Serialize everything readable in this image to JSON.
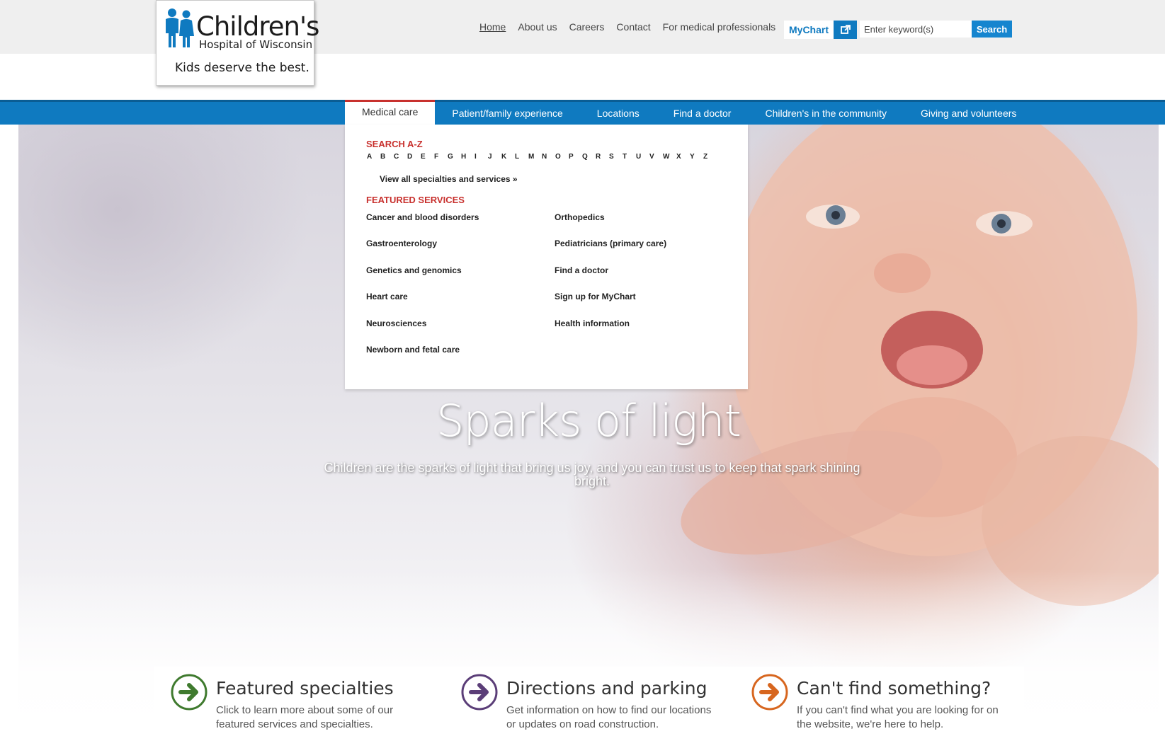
{
  "logo": {
    "name": "Children's",
    "subname": "Hospital of Wisconsin",
    "tagline": "Kids deserve the best."
  },
  "utility_nav": {
    "items": [
      "Home",
      "About us",
      "Careers",
      "Contact",
      "For medical professionals"
    ]
  },
  "mychart": {
    "label": "MyChart",
    "icon": "external-link-icon"
  },
  "search": {
    "placeholder": "Enter keyword(s)",
    "button": "Search"
  },
  "main_nav": {
    "items": [
      "Medical care",
      "Patient/family experience",
      "Locations",
      "Find a doctor",
      "Children's in the community",
      "Giving and volunteers"
    ],
    "active": "Medical care"
  },
  "dropdown": {
    "search_heading": "SEARCH A-Z",
    "letters": [
      "A",
      "B",
      "C",
      "D",
      "E",
      "F",
      "G",
      "H",
      "I",
      "J",
      "K",
      "L",
      "M",
      "N",
      "O",
      "P",
      "Q",
      "R",
      "S",
      "T",
      "U",
      "V",
      "W",
      "X",
      "Y",
      "Z"
    ],
    "view_all": "View all specialties and services »",
    "featured_heading": "FEATURED SERVICES",
    "col1": [
      "Cancer and blood disorders",
      "Gastroenterology",
      "Genetics and genomics",
      "Heart care",
      "Neurosciences",
      "Newborn and fetal care"
    ],
    "col2": [
      "Orthopedics",
      "Pediatricians (primary care)",
      "Find a doctor",
      "Sign up for MyChart",
      "Health information"
    ]
  },
  "hero": {
    "title": "Sparks of light",
    "subtitle": "Children are the sparks of light that bring us joy, and you can trust us to keep that spark shining bright."
  },
  "features": [
    {
      "title": "Featured specialties",
      "desc": "Click to learn more about some of our featured services and specialties.",
      "color": "#3f7a2e",
      "icon": "arrow-right-icon"
    },
    {
      "title": "Directions and parking",
      "desc": "Get information on how to find our locations or updates on road construction.",
      "color": "#5b3e78",
      "icon": "arrow-right-icon"
    },
    {
      "title": "Can't find something?",
      "desc": "If you can't find what you are looking for on the website, we're here to help.",
      "color": "#d7661f",
      "icon": "arrow-right-icon"
    }
  ],
  "colors": {
    "brand_blue": "#0f7ac0",
    "accent_red": "#c8312e"
  }
}
